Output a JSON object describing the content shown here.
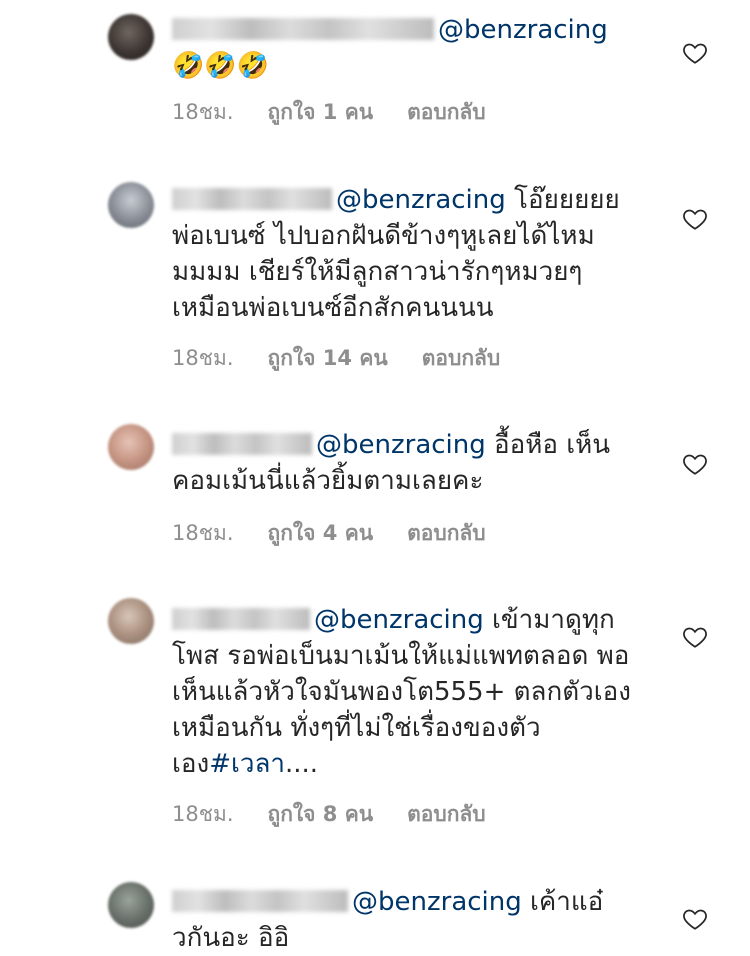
{
  "comments": [
    {
      "mention": "@benzracing",
      "text": "🤣🤣🤣",
      "time": "18ชม.",
      "likes": "ถูกใจ 1 คน",
      "reply": "ตอบกลับ"
    },
    {
      "mention": "@benzracing",
      "text": "โอ๊ยยยยย พ่อเบนซ์ ไปบอกฝันดีข้างๆหูเลยได้ไหมมมมม เชียร์ให้มีลูกสาวน่ารักๆหมวยๆ เหมือนพ่อเบนซ์อีกสักคนนนน",
      "time": "18ชม.",
      "likes": "ถูกใจ 14 คน",
      "reply": "ตอบกลับ"
    },
    {
      "mention": "@benzracing",
      "text": "อื้อหือ เห็นคอมเม้นนี่แล้วยิ้มตามเลยคะ",
      "time": "18ชม.",
      "likes": "ถูกใจ 4 คน",
      "reply": "ตอบกลับ"
    },
    {
      "mention": "@benzracing",
      "text": "เข้ามาดูทุกโพส รอพ่อเบ็นมาเม้นให้แม่แพทตลอด พอเห็นแล้วหัวใจมันพองโต555+ ตลกตัวเองเหมือนกัน ทั่งๆที่ไม่ใช่เรื่องของตัวเอง",
      "hashtag": "#เวลา",
      "trail": "....",
      "time": "18ชม.",
      "likes": "ถูกใจ 8 คน",
      "reply": "ตอบกลับ"
    },
    {
      "mention": "@benzracing",
      "text": "เค้าแอ๋วกันอะ อิอิ"
    }
  ],
  "icons": {
    "like": "heart-outline-icon"
  },
  "colors": {
    "mention": "#003569",
    "meta": "#8e8e8e",
    "text": "#262626"
  }
}
